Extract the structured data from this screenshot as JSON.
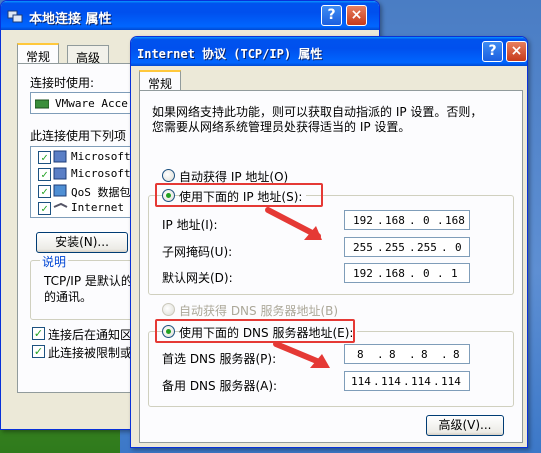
{
  "back_window": {
    "title": "本地连接 属性",
    "tabs": [
      "常规",
      "高级"
    ],
    "connect_using_label": "连接时使用:",
    "adapter_name": "VMware Acce",
    "components_label": "此连接使用下列项",
    "components": [
      "Microsoft",
      "Microsoft",
      "QoS 数据包",
      "Internet"
    ],
    "install_button": "安装(N)...",
    "description_group": "说明",
    "description_text": [
      "TCP/IP 是默认的",
      "的通讯。"
    ],
    "show_icon_checkbox": "连接后在通知区",
    "notify_checkbox": "此连接被限制或"
  },
  "front_window": {
    "title": "Internet 协议 (TCP/IP) 属性",
    "help_glyph": "?",
    "close_glyph": "×",
    "tab": "常规",
    "intro_text": [
      "如果网络支持此功能，则可以获取自动指派的 IP 设置。否则，",
      "您需要从网络系统管理员处获得适当的 IP 设置。"
    ],
    "auto_ip_label": "自动获得 IP 地址(O)",
    "manual_ip_label": "使用下面的 IP 地址(S):",
    "ip_address_label": "IP 地址(I):",
    "subnet_label": "子网掩码(U):",
    "gateway_label": "默认网关(D):",
    "ip_address": [
      "192",
      "168",
      "0",
      "168"
    ],
    "subnet_mask": [
      "255",
      "255",
      "255",
      "0"
    ],
    "gateway": [
      "192",
      "168",
      "0",
      "1"
    ],
    "auto_dns_label": "自动获得 DNS 服务器地址(B)",
    "manual_dns_label": "使用下面的 DNS 服务器地址(E):",
    "preferred_dns_label": "首选 DNS 服务器(P):",
    "alternate_dns_label": "备用 DNS 服务器(A):",
    "preferred_dns": [
      "8",
      "8",
      "8",
      "8"
    ],
    "alternate_dns": [
      "114",
      "114",
      "114",
      "114"
    ],
    "advanced_button": "高级(V)..."
  },
  "colors": {
    "titlebar": "#0053ee",
    "window_bg": "#ece9d8",
    "annotation_red": "#e53935",
    "radio_selected": "#21a121"
  }
}
